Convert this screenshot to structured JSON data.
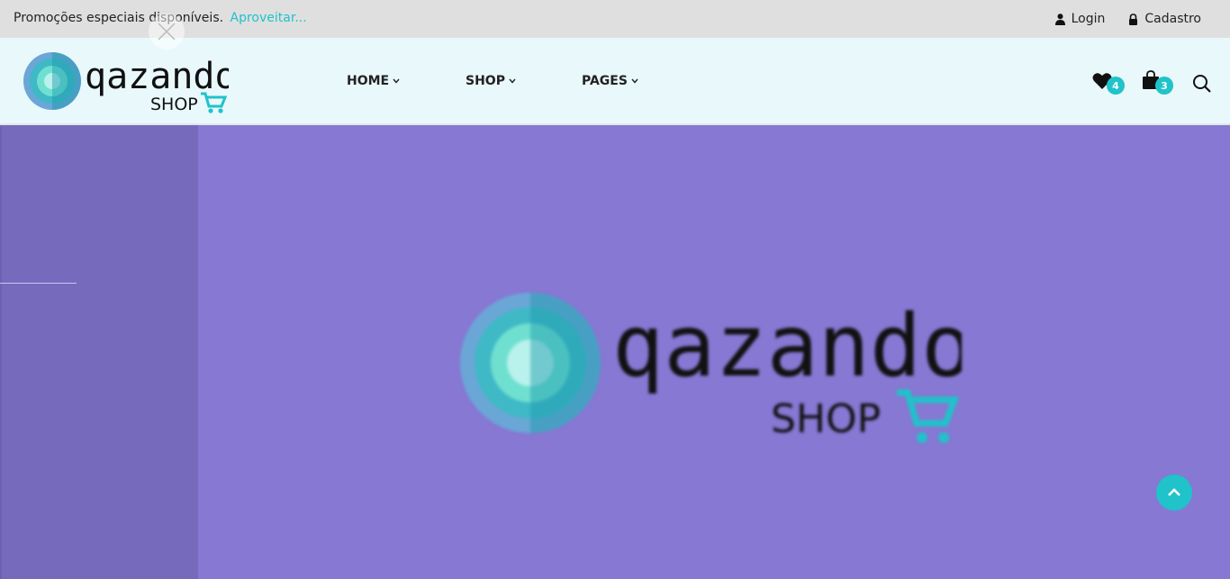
{
  "promo": {
    "text": "Promoções especiais disponíveis.",
    "link": "Aproveitar..."
  },
  "auth": {
    "login": "Login",
    "signup": "Cadastro"
  },
  "brand": {
    "name": "qazando",
    "sub": "SHOP"
  },
  "nav": {
    "items": [
      "HOME",
      "SHOP",
      "PAGES"
    ]
  },
  "header_icons": {
    "wishlist_count": "4",
    "cart_count": "3",
    "icons": [
      "heart-icon",
      "shopping-bag-icon",
      "search-icon"
    ]
  },
  "colors": {
    "accent": "#1fc3c9",
    "hero_bg": "#8678d3",
    "header_bg": "#e9f8fb",
    "topbar_bg": "#dfdfdf"
  }
}
